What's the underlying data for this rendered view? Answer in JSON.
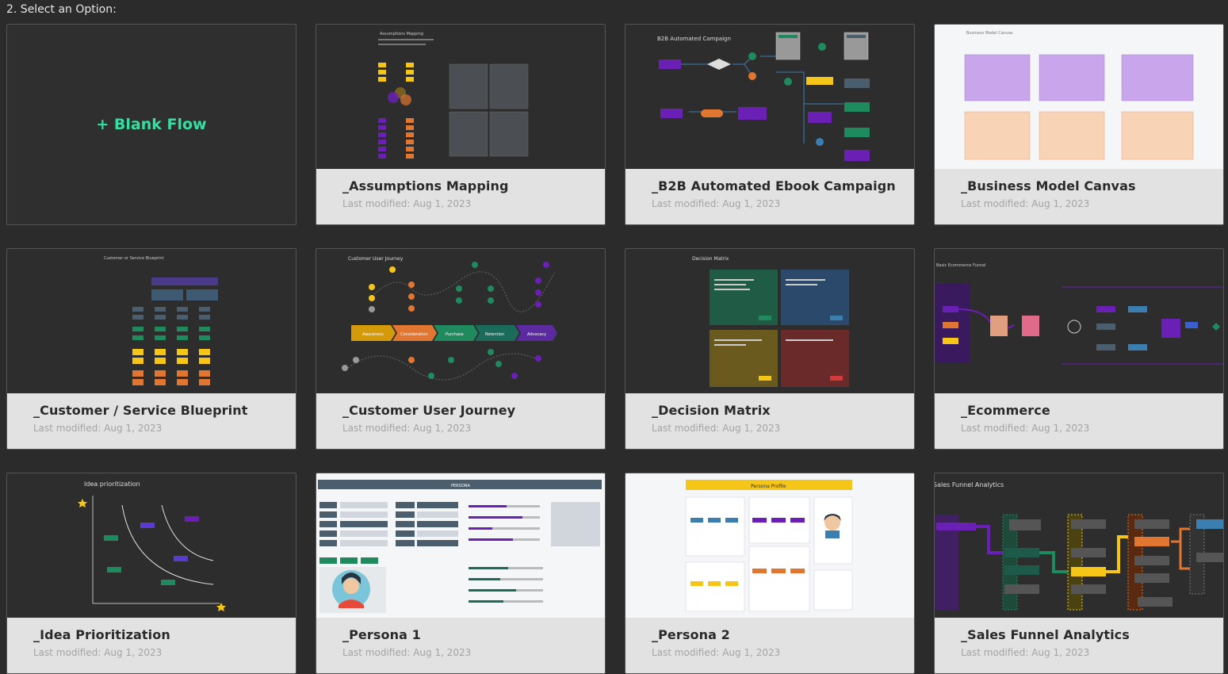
{
  "section_title": "2. Select an Option:",
  "blank": {
    "label": "+ Blank Flow"
  },
  "templates": [
    {
      "name": "_Assumptions Mapping",
      "modified": "Last modified: Aug 1, 2023",
      "thumb_title": "Assumptions Mapping"
    },
    {
      "name": "_B2B Automated Ebook Campaign",
      "modified": "Last modified: Aug 1, 2023",
      "thumb_title": "B2B Automated Campaign"
    },
    {
      "name": "_Business Model Canvas",
      "modified": "Last modified: Aug 1, 2023",
      "thumb_title": "Business Model Canvas"
    },
    {
      "name": "_Customer / Service Blueprint",
      "modified": "Last modified: Aug 1, 2023",
      "thumb_title": "Customer or Service Blueprint"
    },
    {
      "name": "_Customer User Journey",
      "modified": "Last modified: Aug 1, 2023",
      "thumb_title": "Customer User Journey"
    },
    {
      "name": "_Decision Matrix",
      "modified": "Last modified: Aug 1, 2023",
      "thumb_title": "Decision Matrix"
    },
    {
      "name": "_Ecommerce",
      "modified": "Last modified: Aug 1, 2023",
      "thumb_title": "Basic Ecommerce Funnel"
    },
    {
      "name": "_Idea Prioritization",
      "modified": "Last modified: Aug 1, 2023",
      "thumb_title": "Idea prioritization"
    },
    {
      "name": "_Persona 1",
      "modified": "Last modified: Aug 1, 2023",
      "thumb_title": "PERSONA"
    },
    {
      "name": "_Persona 2",
      "modified": "Last modified: Aug 1, 2023",
      "thumb_title": "Persona Profile"
    },
    {
      "name": "_Sales Funnel Analytics",
      "modified": "Last modified: Aug 1, 2023",
      "thumb_title": "Sales Funnel Analytics"
    }
  ],
  "journey_stages": [
    "Awareness",
    "Consideration",
    "Purchase",
    "Retention",
    "Advocacy"
  ],
  "colors": {
    "accent": "#34e0a1",
    "purple": "#6a1fb5",
    "yellow": "#f5c518",
    "orange": "#e0762f",
    "green": "#1e8a5e",
    "slate": "#4a5e6e"
  }
}
